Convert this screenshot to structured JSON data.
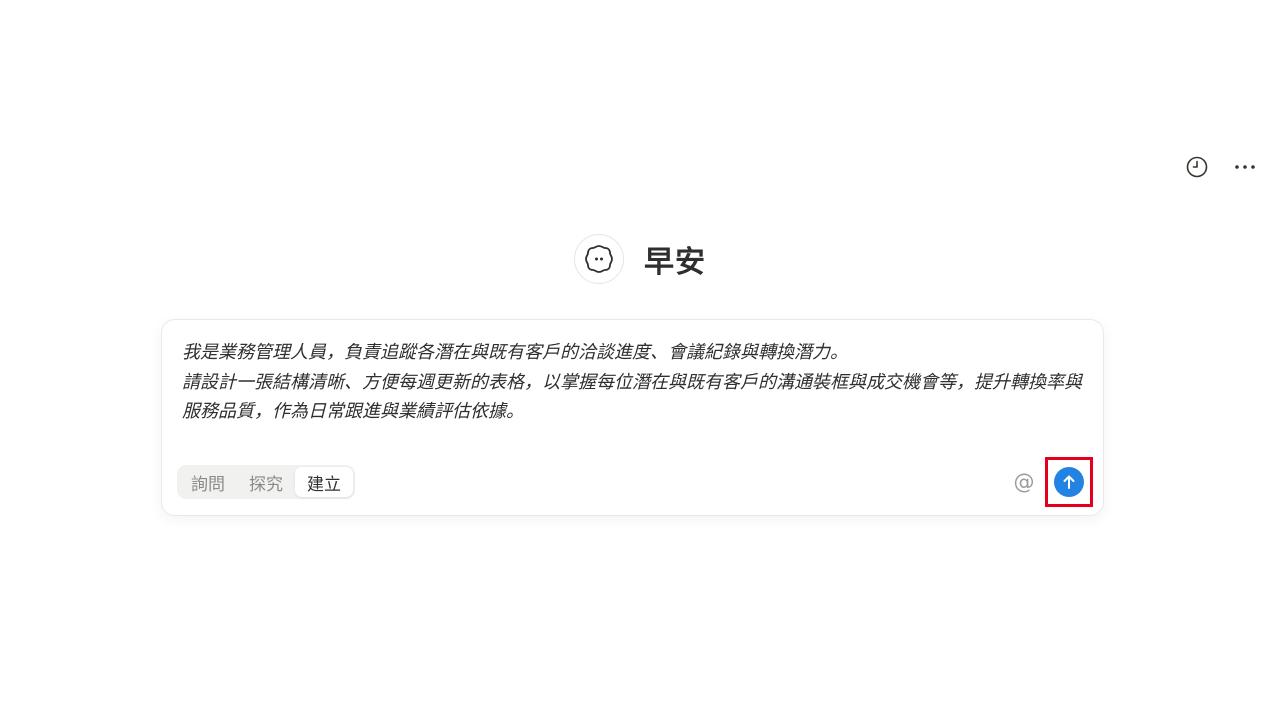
{
  "header": {
    "history_icon": "clock-icon",
    "more_icon": "more-horizontal-icon"
  },
  "greeting": {
    "avatar_icon": "face-avatar-icon",
    "text": "早安"
  },
  "composer": {
    "prompt": "我是業務管理人員，負責追蹤各潛在與既有客戶的洽談進度、會議紀錄與轉換潛力。\n請設計一張結構清晰、方便每週更新的表格，以掌握每位潛在與既有客戶的溝通裝框與成交機會等，提升轉換率與服務品質，作為日常跟進與業績評估依據。",
    "modes": [
      {
        "label": "詢問",
        "active": false
      },
      {
        "label": "探究",
        "active": false
      },
      {
        "label": "建立",
        "active": true
      }
    ],
    "mention_symbol": "@",
    "send_icon": "arrow-up-icon"
  },
  "colors": {
    "accent": "#2383e2",
    "highlight": "#e4001b"
  }
}
